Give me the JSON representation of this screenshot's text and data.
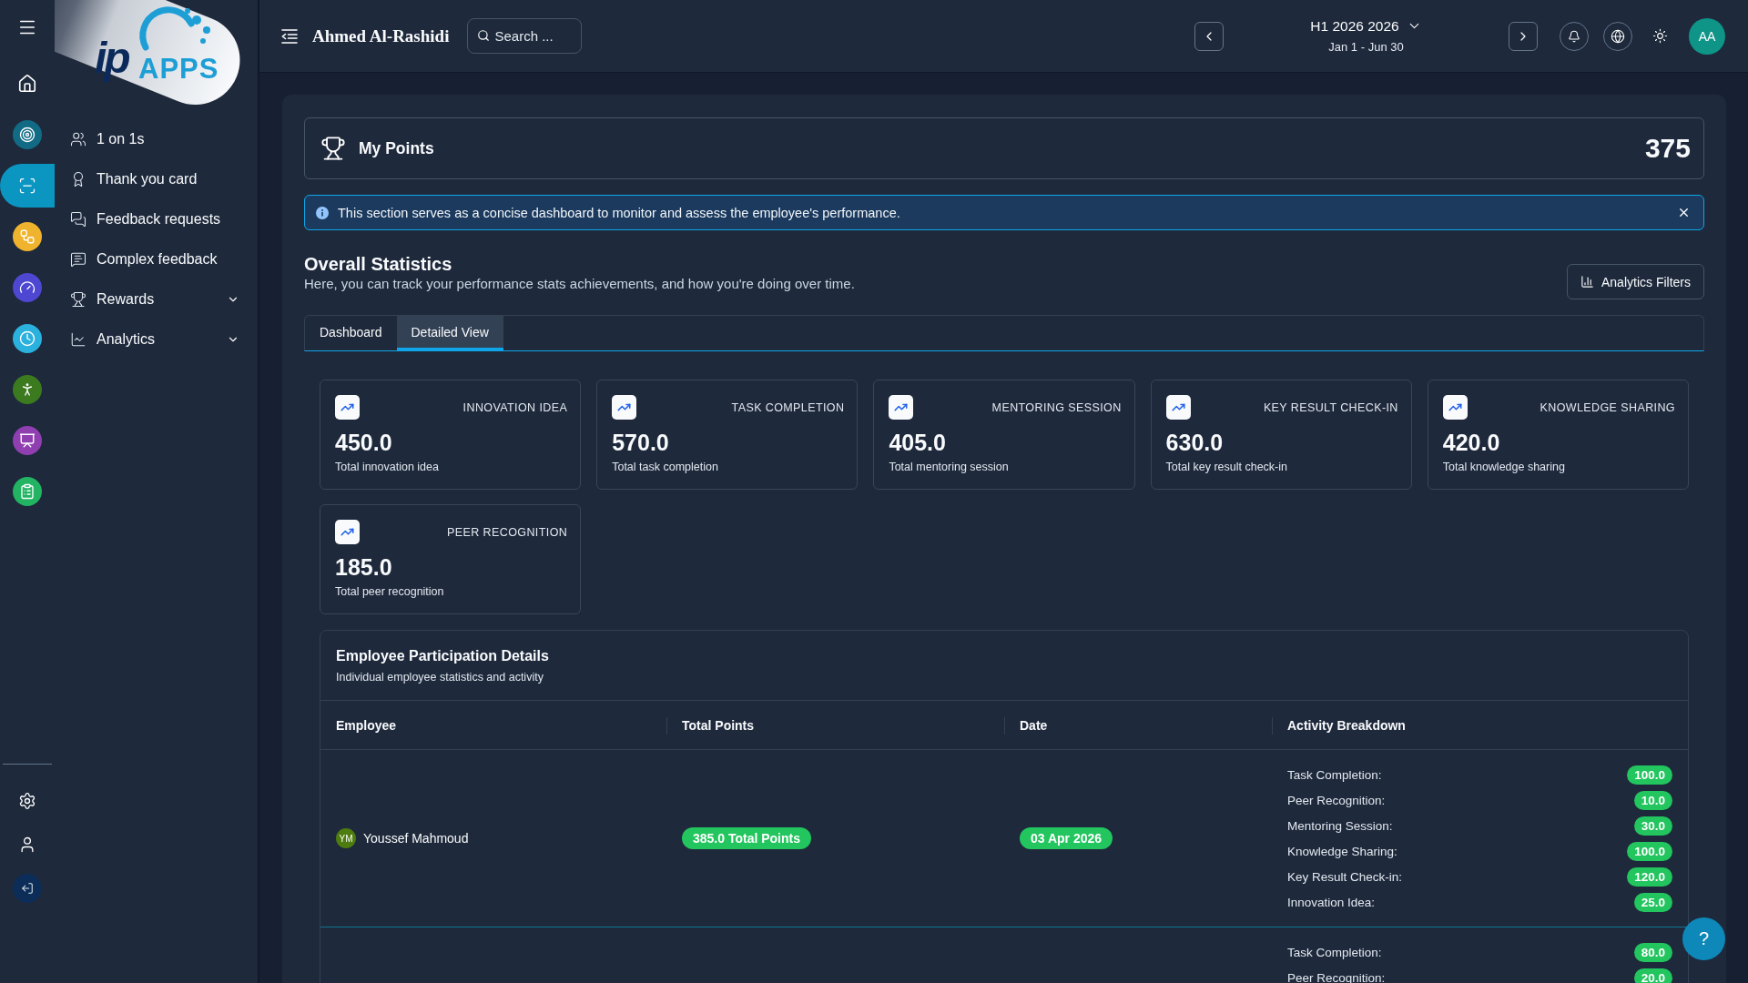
{
  "rail": {
    "items": [
      {
        "color": "#126b85",
        "selected": false
      },
      {
        "color": "#0b96c2",
        "selected": true
      },
      {
        "color": "#f0b32d",
        "selected": false
      },
      {
        "color": "#4e47d1",
        "selected": false
      },
      {
        "color": "#2ab1dd",
        "selected": false
      },
      {
        "color": "#3b7a1f",
        "selected": false
      },
      {
        "color": "#8f3fb0",
        "selected": false
      },
      {
        "color": "#22b363",
        "selected": false
      }
    ]
  },
  "logo": {
    "mark": "ip",
    "text": "APPS"
  },
  "sidebar": {
    "items": [
      {
        "label": "1 on 1s",
        "kind": "link"
      },
      {
        "label": "Thank you card",
        "kind": "link"
      },
      {
        "label": "Feedback requests",
        "kind": "link"
      },
      {
        "label": "Complex feedback",
        "kind": "link"
      },
      {
        "label": "Rewards",
        "kind": "group",
        "expanded": false
      },
      {
        "label": "Analytics",
        "kind": "group",
        "expanded": false
      }
    ]
  },
  "topbar": {
    "user_name": "Ahmed Al-Rashidi",
    "search": {
      "placeholder": "Search ..."
    },
    "period": {
      "title": "H1 2026 2026",
      "range": "Jan 1 - Jun 30"
    },
    "avatar": "AA"
  },
  "points_card": {
    "title": "My Points",
    "value": "375"
  },
  "info_banner": {
    "text": "This section serves as a concise dashboard to monitor and assess the employee's performance."
  },
  "overall_statistics": {
    "title": "Overall Statistics",
    "subtitle": "Here, you can track your performance stats achievements, and how you're doing over time.",
    "filter_button": "Analytics Filters"
  },
  "tabs": [
    {
      "label": "Dashboard",
      "selected": false
    },
    {
      "label": "Detailed View",
      "selected": true
    }
  ],
  "stat_cards": [
    {
      "label": "INNOVATION IDEA",
      "value": "450.0",
      "caption": "Total innovation idea"
    },
    {
      "label": "TASK COMPLETION",
      "value": "570.0",
      "caption": "Total task completion"
    },
    {
      "label": "MENTORING SESSION",
      "value": "405.0",
      "caption": "Total mentoring session"
    },
    {
      "label": "KEY RESULT CHECK-IN",
      "value": "630.0",
      "caption": "Total key result check-in"
    },
    {
      "label": "KNOWLEDGE SHARING",
      "value": "420.0",
      "caption": "Total knowledge sharing"
    },
    {
      "label": "PEER RECOGNITION",
      "value": "185.0",
      "caption": "Total peer recognition"
    }
  ],
  "participation": {
    "title": "Employee Participation Details",
    "subtitle": "Individual employee statistics and activity",
    "columns": [
      "Employee",
      "Total Points",
      "Date",
      "Activity Breakdown"
    ],
    "rows": [
      {
        "initials": "YM",
        "name": "Youssef Mahmoud",
        "total_points": "385.0 Total Points",
        "date": "03 Apr 2026",
        "breakdown": [
          {
            "label": "Task Completion:",
            "value": "100.0"
          },
          {
            "label": "Peer Recognition:",
            "value": "10.0"
          },
          {
            "label": "Mentoring Session:",
            "value": "30.0"
          },
          {
            "label": "Knowledge Sharing:",
            "value": "100.0"
          },
          {
            "label": "Key Result Check-in:",
            "value": "120.0"
          },
          {
            "label": "Innovation Idea:",
            "value": "25.0"
          }
        ]
      },
      {
        "breakdown": [
          {
            "label": "Task Completion:",
            "value": "80.0"
          },
          {
            "label": "Peer Recognition:",
            "value": "20.0"
          }
        ]
      }
    ]
  },
  "help_button": {
    "label": "?"
  }
}
